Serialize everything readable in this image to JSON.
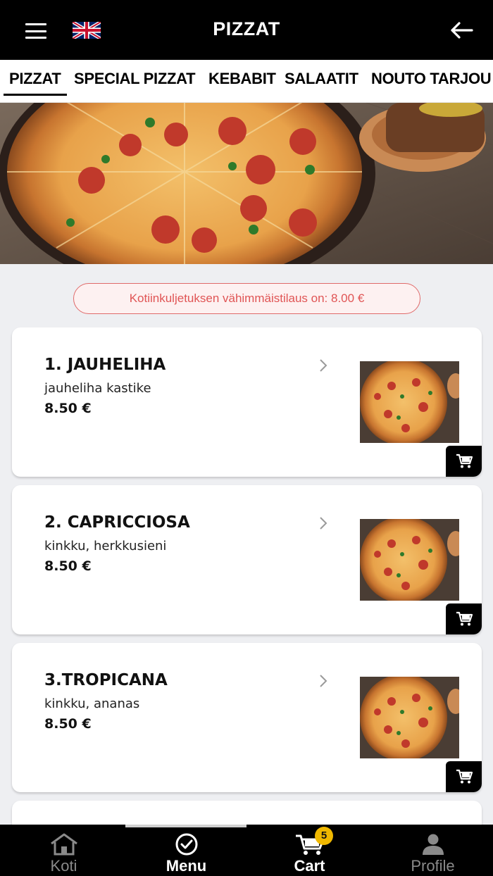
{
  "header": {
    "title": "PIZZAT",
    "menu_icon": "hamburger-menu-icon",
    "language_icon": "uk-flag-icon",
    "back_icon": "arrow-left-icon"
  },
  "tabs": [
    {
      "label": "PIZZAT",
      "active": true
    },
    {
      "label": "SPECIAL PIZZAT",
      "active": false
    },
    {
      "label": "KEBABIT",
      "active": false
    },
    {
      "label": "SALAATIT",
      "active": false
    },
    {
      "label": "NOUTO TARJOU",
      "active": false
    }
  ],
  "notice": {
    "min_order": "Kotiinkuljetuksen vähimmäistilaus on: 8.00 €"
  },
  "products": [
    {
      "name": "1. JAUHELIHA",
      "description": "jauheliha kastike",
      "price": "8.50 €"
    },
    {
      "name": "2. CAPRICCIOSA",
      "description": "kinkku, herkkusieni",
      "price": "8.50 €"
    },
    {
      "name": "3.TROPICANA",
      "description": "kinkku, ananas",
      "price": "8.50 €"
    }
  ],
  "bottom_nav": {
    "items": [
      {
        "label": "Koti",
        "icon": "home-icon",
        "active": false
      },
      {
        "label": "Menu",
        "icon": "check-circle-icon",
        "active": true
      },
      {
        "label": "Cart",
        "icon": "cart-icon",
        "active": false,
        "badge": "5"
      },
      {
        "label": "Profile",
        "icon": "user-icon",
        "active": false
      }
    ]
  },
  "colors": {
    "header_bg": "#000000",
    "notice_border": "#e06a6a",
    "notice_text": "#e05555",
    "badge": "#f0b800",
    "page_bg": "#eeeff2"
  }
}
